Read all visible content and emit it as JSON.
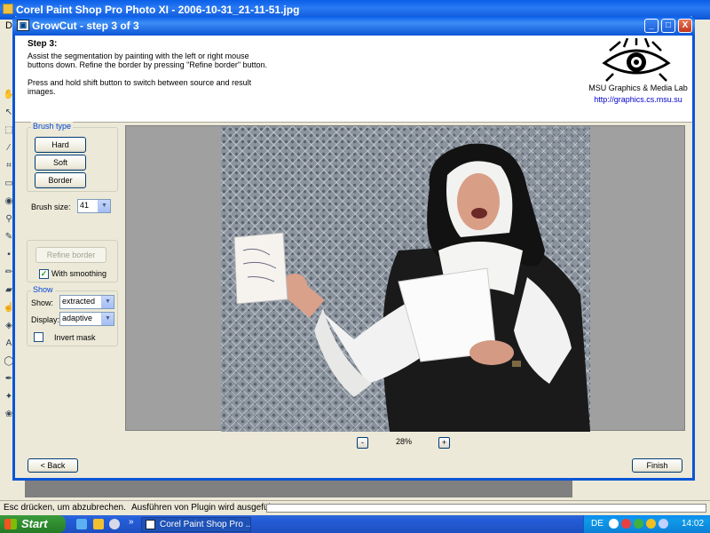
{
  "background_app": {
    "title": "Corel Paint Shop Pro Photo XI - 2006-10-31_21-11-51.jpg",
    "menu_first": "Da"
  },
  "dialog": {
    "title": "GrowCut - step 3 of 3",
    "window_buttons": {
      "minimize": "_",
      "maximize": "□",
      "close": "X"
    },
    "header": {
      "step_title": "Step 3:",
      "instructions": "Assist the segmentation by painting with the left or right mouse\nbuttons down. Refine the border by pressing \"Refine border\" button.\n\nPress and hold shift button to switch between source and result\nimages.",
      "logo_text": "MSU Graphics & Media Lab",
      "logo_url": "http://graphics.cs.msu.su"
    },
    "brush_type": {
      "label": "Brush type",
      "buttons": [
        "Hard",
        "Soft",
        "Border"
      ]
    },
    "brush_size": {
      "label": "Brush size:",
      "value": "41"
    },
    "refine": {
      "button": "Refine border",
      "with_smoothing_label": "With smoothing",
      "with_smoothing_checked": true
    },
    "show_group": {
      "label": "Show",
      "show_label": "Show:",
      "show_value": "extracted",
      "display_label": "Display:",
      "display_value": "adaptive",
      "invert_mask_label": "Invert mask",
      "invert_mask_checked": false
    },
    "zoom": {
      "minus": "-",
      "value": "28%",
      "plus": "+"
    },
    "back_button": "< Back",
    "finish_button": "Finish"
  },
  "statusbar": {
    "left_text": "Esc drücken, um abzubrechen.",
    "right_text": "Ausführen von Plugin wird ausgeführt..."
  },
  "taskbar": {
    "start_label": "Start",
    "task_label": "Corel Paint Shop Pro ...",
    "language": "DE",
    "clock": "14:02"
  },
  "colors": {
    "xp_blue": "#0b55d6",
    "dialog_bg": "#ece9d8",
    "group_label": "#0046d5",
    "start_green": "#2f8d2f"
  }
}
